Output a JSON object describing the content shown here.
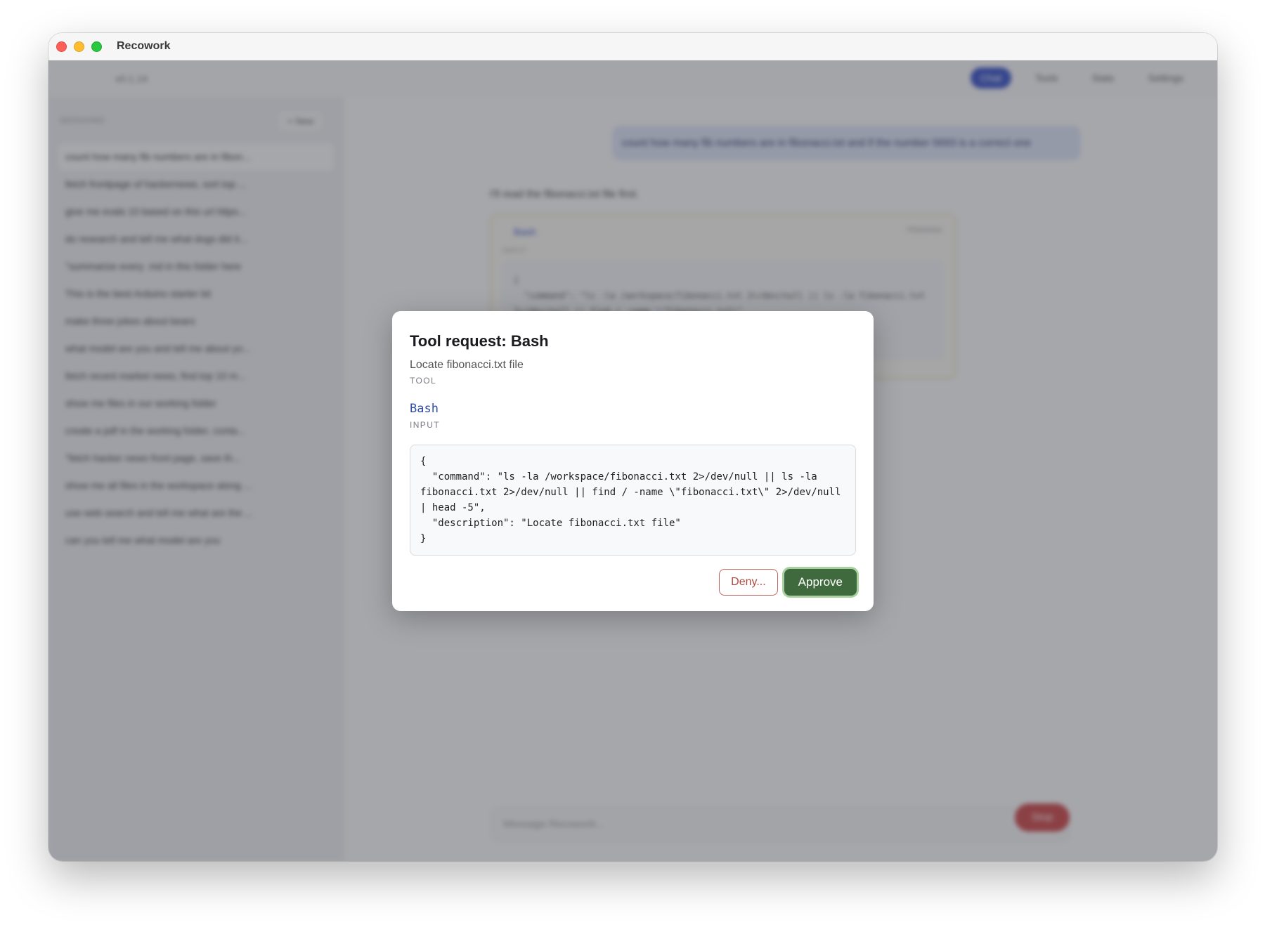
{
  "window": {
    "title": "Recowork"
  },
  "topbar": {
    "version": "v0.1.14",
    "tabs": [
      {
        "label": "Chat",
        "active": true
      },
      {
        "label": "Tools",
        "active": false
      },
      {
        "label": "Stats",
        "active": false
      },
      {
        "label": "Settings",
        "active": false
      }
    ]
  },
  "sidebar": {
    "heading": "SESSIONS",
    "new_label": "+ New",
    "items": [
      "count how many fib numbers are in fibon...",
      "fetch frontpage of hackernews, sort top ...",
      "give me evals 10 based on this url https...",
      "do research and tell me what dogs did it...",
      "\"summarize every .md in this folder here",
      "This is the best Arduino starter kit",
      "make three jokes about bears",
      "what model are you and tell me about yo...",
      "fetch recent market news, find top 10 m...",
      "show me files in our working folder",
      "create a pdf in the working folder, conta...",
      " \"fetch hacker news front page, save th...",
      "show me all files in the workspace along ...",
      "use web search and tell me what are the ...",
      "can you tell me what model are you"
    ]
  },
  "chat": {
    "user_message": "count how many fib numbers are in fibonacci.txt and if the number 5693 is a correct one",
    "assistant_text": "I'll read the fibonacci.txt file first.",
    "toolcard": {
      "name": "Bash",
      "status": "PENDING",
      "input_label": "INPUT",
      "code": "{\n  \"command\": \"ls -la /workspace/fibonacci.txt 2>/dev/null || ls -la fibonacci.txt 2>/dev/null || find / -name \\\"fibonacci.txt\\\"\n}"
    },
    "composer_placeholder": "Message Recowork...",
    "stop_label": "Stop"
  },
  "modal": {
    "title": "Tool request: Bash",
    "description": "Locate fibonacci.txt file",
    "tool_label": "TOOL",
    "tool_name": "Bash",
    "input_label": "INPUT",
    "input_json": "{\n  \"command\": \"ls -la /workspace/fibonacci.txt 2>/dev/null || ls -la fibonacci.txt 2>/dev/null || find / -name \\\"fibonacci.txt\\\" 2>/dev/null | head -5\",\n  \"description\": \"Locate fibonacci.txt file\"\n}",
    "deny_label": "Deny...",
    "approve_label": "Approve"
  },
  "colors": {
    "accent": "#2b47c7",
    "approve": "#3f6a3e",
    "deny": "#b3473d",
    "stop": "#cc3b3b"
  }
}
